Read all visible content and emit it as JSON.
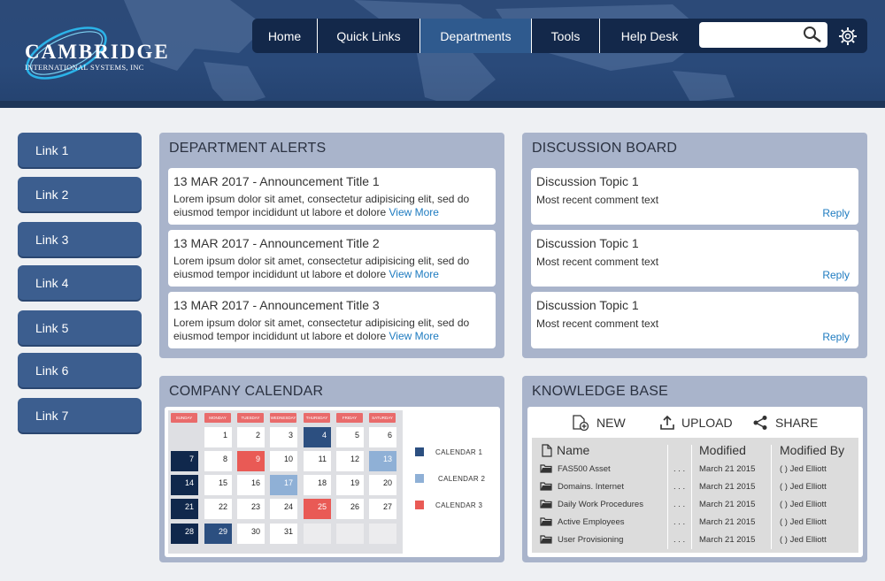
{
  "brand": {
    "name": "CAMBRIDGE",
    "sub": "INTERNATIONAL SYSTEMS, INC"
  },
  "nav": {
    "items": [
      "Home",
      "Quick Links",
      "Departments",
      "Tools",
      "Help Desk"
    ],
    "active": "Departments",
    "search_placeholder": ""
  },
  "sidebar": {
    "links": [
      "Link 1",
      "Link 2",
      "Link 3",
      "Link 4",
      "Link 5",
      "Link 6",
      "Link 7"
    ]
  },
  "alerts": {
    "title": "DEPARTMENT ALERTS",
    "items": [
      {
        "title": "13 MAR 2017 - Announcement Title 1",
        "body": "Lorem ipsum dolor sit amet, consectetur adipisicing elit, sed do eiusmod tempor incididunt ut labore et dolore",
        "more": "View More"
      },
      {
        "title": "13 MAR 2017 - Announcement Title 2",
        "body": "Lorem ipsum dolor sit amet, consectetur adipisicing elit, sed do eiusmod tempor incididunt ut labore et dolore",
        "more": "View More"
      },
      {
        "title": "13 MAR 2017 - Announcement Title 3",
        "body": "Lorem ipsum dolor sit amet, consectetur adipisicing elit, sed do eiusmod tempor incididunt ut labore et dolore",
        "more": "View More"
      }
    ]
  },
  "discussion": {
    "title": "DISCUSSION BOARD",
    "items": [
      {
        "title": "Discussion Topic 1",
        "comment": "Most recent comment text",
        "reply": "Reply"
      },
      {
        "title": "Discussion Topic 1",
        "comment": "Most recent comment text",
        "reply": "Reply"
      },
      {
        "title": "Discussion Topic 1",
        "comment": "Most recent comment text",
        "reply": "Reply"
      }
    ]
  },
  "calendar": {
    "title": "COMPANY CALENDAR",
    "days": [
      "SUNDAY",
      "MONDAY",
      "TUESDAY",
      "WEDNESDAY",
      "THURSDAY",
      "FRIDAY",
      "SATURDAY"
    ],
    "weeks": [
      [
        null,
        "1",
        "2",
        "3",
        "4",
        "5",
        "6",
        "7"
      ],
      [
        "8",
        "9",
        "10",
        "11",
        "12",
        "13",
        "14"
      ],
      [
        "15",
        "16",
        "17",
        "18",
        "19",
        "20",
        "21"
      ],
      [
        "22",
        "23",
        "24",
        "25",
        "26",
        "27",
        "28"
      ],
      [
        "29",
        "30",
        "31",
        "",
        "",
        "",
        ""
      ]
    ],
    "events": {
      "4": "calendar1",
      "29": "calendar1",
      "13": "calendar2",
      "17": "calendar2",
      "9": "calendar3",
      "25": "calendar3",
      "7": "dark",
      "14": "dark",
      "21": "dark",
      "28": "dark"
    },
    "legend": [
      {
        "label": "CALENDAR 1",
        "color": "#2c4f80"
      },
      {
        "label": "CALENDAR 2",
        "color": "#8fb0d6"
      },
      {
        "label": "CALENDAR 3",
        "color": "#e95a55"
      }
    ]
  },
  "kb": {
    "title": "KNOWLEDGE BASE",
    "tools": [
      "NEW",
      "UPLOAD",
      "SHARE"
    ],
    "headers": [
      "Name",
      "Modified",
      "Modified By"
    ],
    "rows": [
      {
        "name": "FAS500 Asset",
        "dots": ". . .",
        "modified": "March 21 2015",
        "by": "( ) Jed Elliott"
      },
      {
        "name": "Domains. Internet",
        "dots": ". . .",
        "modified": "March 21 2015",
        "by": "( ) Jed Elliott"
      },
      {
        "name": "Daily Work Procedures",
        "dots": ". . .",
        "modified": "March 21 2015",
        "by": "( ) Jed Elliott"
      },
      {
        "name": "Active Employees",
        "dots": ". . .",
        "modified": "March 21 2015",
        "by": "( ) Jed Elliott"
      },
      {
        "name": "User Provisioning",
        "dots": ". . .",
        "modified": "March 21 2015",
        "by": "( ) Jed Elliott"
      }
    ]
  }
}
